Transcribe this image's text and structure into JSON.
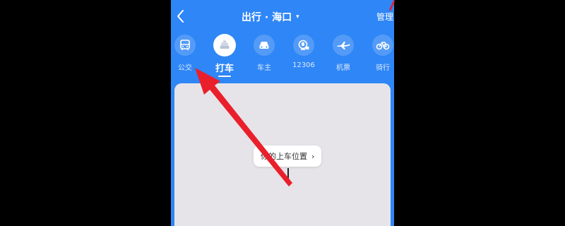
{
  "header": {
    "back_icon": "chevron-left-icon",
    "title": "出行 · 海口",
    "caret": "▾",
    "manage_label": "管理"
  },
  "tabs": [
    {
      "label": "公交",
      "icon": "bus-icon",
      "active": false
    },
    {
      "label": "打车",
      "icon": "taxi-icon",
      "active": true
    },
    {
      "label": "车主",
      "icon": "car-icon",
      "active": false
    },
    {
      "label": "12306",
      "icon": "train-icon",
      "active": false
    },
    {
      "label": "机票",
      "icon": "plane-icon",
      "active": false
    },
    {
      "label": "骑行",
      "icon": "bike-icon",
      "active": false
    }
  ],
  "map": {
    "pickup_label": "你的上车位置",
    "pickup_chevron": "›"
  },
  "colors": {
    "brand_blue": "#2f86f6",
    "arrow_red": "#ea1f2c",
    "map_bg": "#e6e4e8"
  }
}
